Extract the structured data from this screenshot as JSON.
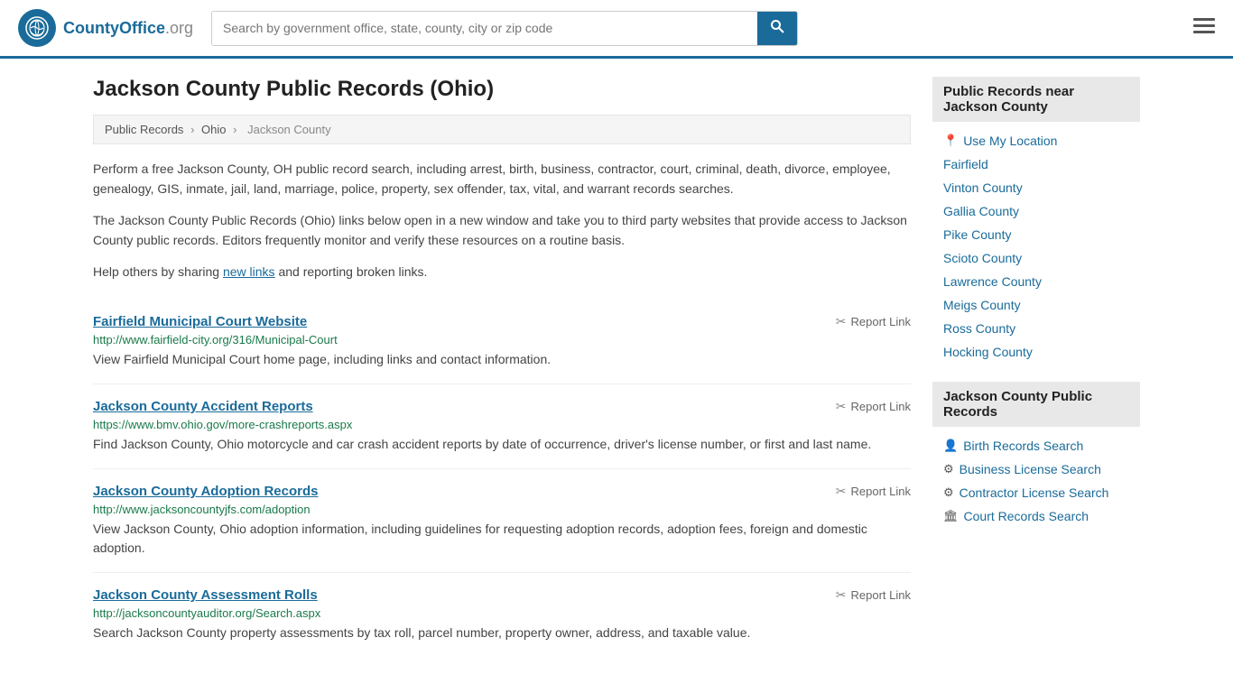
{
  "header": {
    "logo_text": "CountyOffice",
    "logo_tld": ".org",
    "search_placeholder": "Search by government office, state, county, city or zip code",
    "search_label": "Search"
  },
  "page": {
    "title": "Jackson County Public Records (Ohio)",
    "breadcrumb": {
      "items": [
        "Public Records",
        "Ohio",
        "Jackson County"
      ]
    },
    "description1": "Perform a free Jackson County, OH public record search, including arrest, birth, business, contractor, court, criminal, death, divorce, employee, genealogy, GIS, inmate, jail, land, marriage, police, property, sex offender, tax, vital, and warrant records searches.",
    "description2": "The Jackson County Public Records (Ohio) links below open in a new window and take you to third party websites that provide access to Jackson County public records. Editors frequently monitor and verify these resources on a routine basis.",
    "description3_prefix": "Help others by sharing ",
    "description3_link": "new links",
    "description3_suffix": " and reporting broken links.",
    "records": [
      {
        "title": "Fairfield Municipal Court Website",
        "url": "http://www.fairfield-city.org/316/Municipal-Court",
        "description": "View Fairfield Municipal Court home page, including links and contact information.",
        "report": "Report Link"
      },
      {
        "title": "Jackson County Accident Reports",
        "url": "https://www.bmv.ohio.gov/more-crashreports.aspx",
        "description": "Find Jackson County, Ohio motorcycle and car crash accident reports by date of occurrence, driver's license number, or first and last name.",
        "report": "Report Link"
      },
      {
        "title": "Jackson County Adoption Records",
        "url": "http://www.jacksoncountyjfs.com/adoption",
        "description": "View Jackson County, Ohio adoption information, including guidelines for requesting adoption records, adoption fees, foreign and domestic adoption.",
        "report": "Report Link"
      },
      {
        "title": "Jackson County Assessment Rolls",
        "url": "http://jacksoncountyauditor.org/Search.aspx",
        "description": "Search Jackson County property assessments by tax roll, parcel number, property owner, address, and taxable value.",
        "report": "Report Link"
      }
    ]
  },
  "sidebar": {
    "nearby_title": "Public Records near Jackson County",
    "nearby_items": [
      {
        "label": "Use My Location",
        "icon": "📍",
        "type": "location"
      },
      {
        "label": "Fairfield",
        "icon": "",
        "type": "plain"
      },
      {
        "label": "Vinton County",
        "icon": "",
        "type": "plain"
      },
      {
        "label": "Gallia County",
        "icon": "",
        "type": "plain"
      },
      {
        "label": "Pike County",
        "icon": "",
        "type": "plain"
      },
      {
        "label": "Scioto County",
        "icon": "",
        "type": "plain"
      },
      {
        "label": "Lawrence County",
        "icon": "",
        "type": "plain"
      },
      {
        "label": "Meigs County",
        "icon": "",
        "type": "plain"
      },
      {
        "label": "Ross County",
        "icon": "",
        "type": "plain"
      },
      {
        "label": "Hocking County",
        "icon": "",
        "type": "plain"
      }
    ],
    "records_title": "Jackson County Public Records",
    "records_items": [
      {
        "label": "Birth Records Search",
        "icon": "👤"
      },
      {
        "label": "Business License Search",
        "icon": "⚙"
      },
      {
        "label": "Contractor License Search",
        "icon": "⚙"
      },
      {
        "label": "Court Records Search",
        "icon": "🏛"
      }
    ]
  }
}
